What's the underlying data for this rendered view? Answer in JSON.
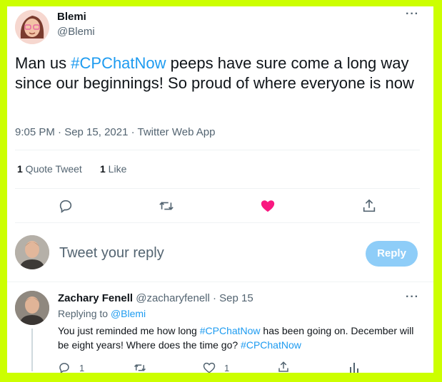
{
  "tweet": {
    "author_name": "Blemi",
    "handle": "@Blemi",
    "text_before": "Man us ",
    "hashtag": "#CPChatNow",
    "text_after": " peeps have sure come a long way since our beginnings! So proud of where everyone is now",
    "meta": "9:05 PM · Sep 15, 2021 · Twitter Web App",
    "quote_count": "1",
    "quote_label": " Quote Tweet",
    "like_count": "1",
    "like_label": " Like"
  },
  "composer": {
    "placeholder": "Tweet your reply",
    "button_label": "Reply"
  },
  "reply": {
    "author_name": "Zachary Fenell",
    "handle_time": "@zacharyfenell · Sep 15",
    "replying_to_label": "Replying to ",
    "replying_to_handle": "@Blemi",
    "text_1": "You just reminded me how long ",
    "hashtag_1": "#CPChatNow",
    "text_2": " has been going on. December will be eight years! Where does the time go? ",
    "hashtag_2": "#CPChatNow",
    "reply_count": "1",
    "like_count": "1"
  },
  "colors": {
    "frame": "#ccff00",
    "accent": "#1d9bf0",
    "like": "#f91880",
    "reply_button": "#8ecdf8"
  },
  "icons": [
    "more-icon",
    "reply-icon",
    "retweet-icon",
    "heart-icon",
    "share-icon",
    "analytics-icon"
  ]
}
